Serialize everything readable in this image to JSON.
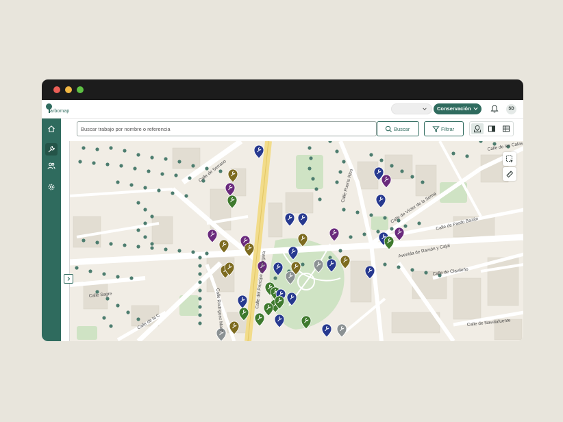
{
  "app": {
    "logo_text": "arbomap"
  },
  "header": {
    "context_select": {
      "value": ""
    },
    "mode_select": {
      "value": "Conservación"
    },
    "notifications_icon": "bell-icon",
    "user_initials": "SD"
  },
  "sidebar": {
    "items": [
      {
        "id": "home",
        "icon": "home-icon"
      },
      {
        "id": "works",
        "icon": "wrench-icon",
        "active": true
      },
      {
        "id": "users",
        "icon": "users-icon"
      },
      {
        "id": "settings",
        "icon": "gear-icon"
      }
    ]
  },
  "search": {
    "value": "",
    "placeholder": "Buscar trabajo por nombre o referencia",
    "button_label": "Buscar",
    "filter_label": "Filtrar"
  },
  "view_modes": [
    {
      "id": "map",
      "icon": "map-icon",
      "active": true
    },
    {
      "id": "split",
      "icon": "split-view-icon"
    },
    {
      "id": "table",
      "icon": "table-icon"
    }
  ],
  "map": {
    "streets": [
      "Calle de Serrano",
      "Calle del Príncipe de Vergara",
      "Calle de Víctor de la Serna",
      "Calle de Pardo Bazán",
      "Avenida de Ramón y Cajal",
      "Calle de Clavileño",
      "Calle de las Calas",
      "Calle de Navalafuente",
      "Calle Sagre",
      "Calle de la C",
      "Calle Rodríguez Marín",
      "Calle Puerto Rico"
    ],
    "tools": [
      "lasso-select-icon",
      "ruler-icon"
    ],
    "colors": {
      "tree": "#4d7d6f",
      "navy": "#27398f",
      "purple": "#6a2a7c",
      "olive": "#7d6b1f",
      "green": "#3f7a2e",
      "gray": "#8b9193",
      "park": "#cfe3c4",
      "road": "#ffffff",
      "avenue": "#f2dc8a"
    }
  }
}
